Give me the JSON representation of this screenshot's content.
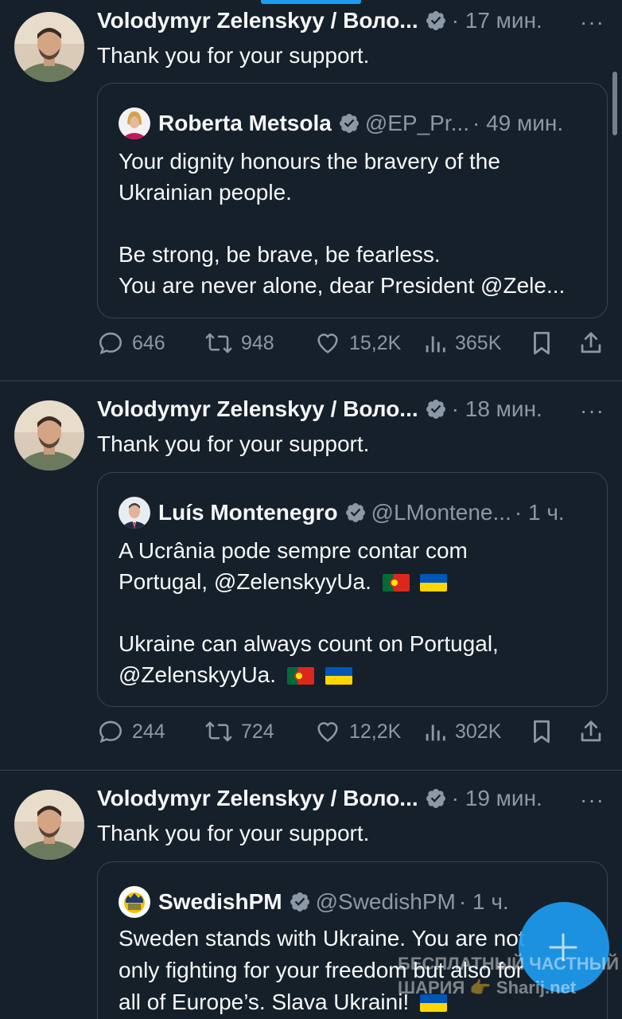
{
  "tweets": [
    {
      "author": "Volodymyr Zelenskyy / Воло...",
      "time": "· 17 мин.",
      "more": "···",
      "text": "Thank you for your support.",
      "quote": {
        "name": "Roberta Metsola",
        "handle": "@EP_Pr...",
        "time": "· 49 мин.",
        "lines": [
          "Your dignity honours the bravery of the",
          "Ukrainian people.",
          "",
          "Be strong, be brave, be fearless.",
          "You are never alone, dear President @Zele..."
        ]
      },
      "stats": {
        "replies": "646",
        "reposts": "948",
        "likes": "15,2K",
        "views": "365K"
      }
    },
    {
      "author": "Volodymyr Zelenskyy / Воло...",
      "time": "· 18 мин.",
      "more": "···",
      "text": "Thank you for your support.",
      "quote": {
        "name": "Luís Montenegro",
        "handle": "@LMontene...",
        "time": "· 1 ч.",
        "lines": [
          "A Ucrânia pode sempre contar com",
          "Portugal, @ZelenskyyUa.",
          "",
          "Ukraine can always count on Portugal,",
          "@ZelenskyyUa."
        ]
      },
      "stats": {
        "replies": "244",
        "reposts": "724",
        "likes": "12,2K",
        "views": "302K"
      }
    },
    {
      "author": "Volodymyr Zelenskyy / Воло...",
      "time": "· 19 мин.",
      "more": "···",
      "text": "Thank you for your support.",
      "quote": {
        "name": "SwedishPM",
        "handle": "@SwedishPM",
        "time": "· 1 ч.",
        "lines": [
          "Sweden stands with Ukraine. You are not",
          "only fighting for your freedom but also for",
          "all of Europe’s. Slava Ukraini!"
        ]
      }
    }
  ],
  "watermark": {
    "line1": "БЕСПЛАТНЫЙ ЧАСТНЫЙ",
    "line2": "ШАРИЯ 👉 Sharij.net"
  },
  "colors": {
    "background": "#15202b",
    "accent": "#1d9bf0",
    "muted": "#8b98a5",
    "border": "#38444d"
  }
}
